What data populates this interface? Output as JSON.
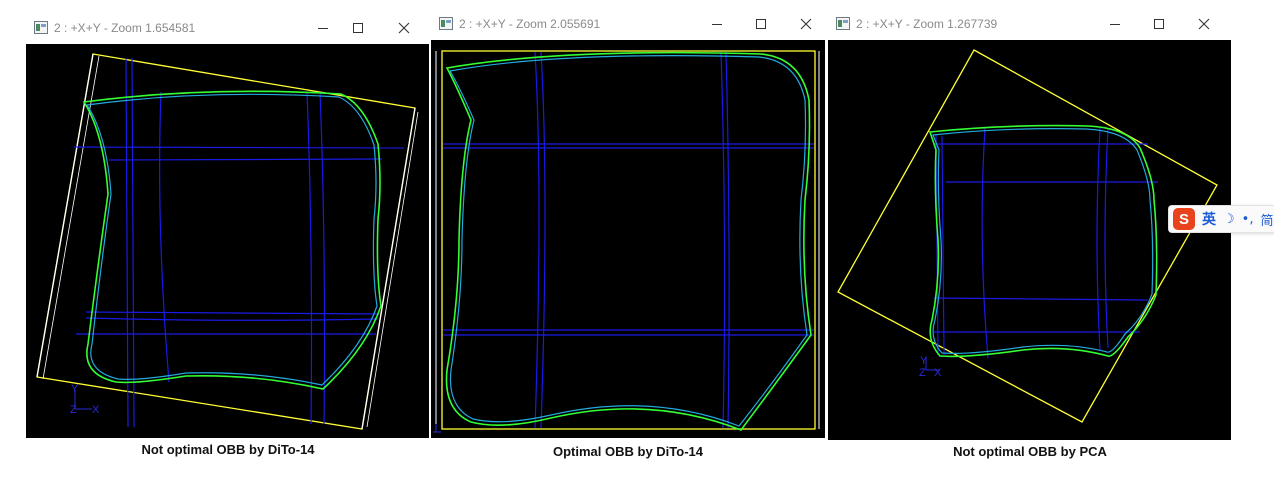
{
  "windows": [
    {
      "title": "2 : +X+Y - Zoom 1.654581",
      "caption": "Not optimal OBB by DiTo-14",
      "axis": {
        "y": "Y",
        "z": "Z",
        "x": "X"
      }
    },
    {
      "title": "2 : +X+Y - Zoom 2.055691",
      "caption": "Optimal OBB by DiTo-14",
      "axis": {
        "y": "",
        "z": "",
        "x": ""
      }
    },
    {
      "title": "2 : +X+Y - Zoom 1.267739",
      "caption": "Not optimal OBB by PCA",
      "axis": {
        "y": "Y",
        "z": "Z",
        "x": "X"
      }
    }
  ],
  "ime_toolbar": {
    "logo": "S",
    "mode": "英",
    "moon_icon": "☽",
    "punct": "•,",
    "more": "简"
  },
  "colors": {
    "viewport": "#000000",
    "obb": "#ffff33",
    "grid": "#1a1ae6",
    "contour_outer": "#33ff33",
    "contour_inner": "#22aadd"
  }
}
